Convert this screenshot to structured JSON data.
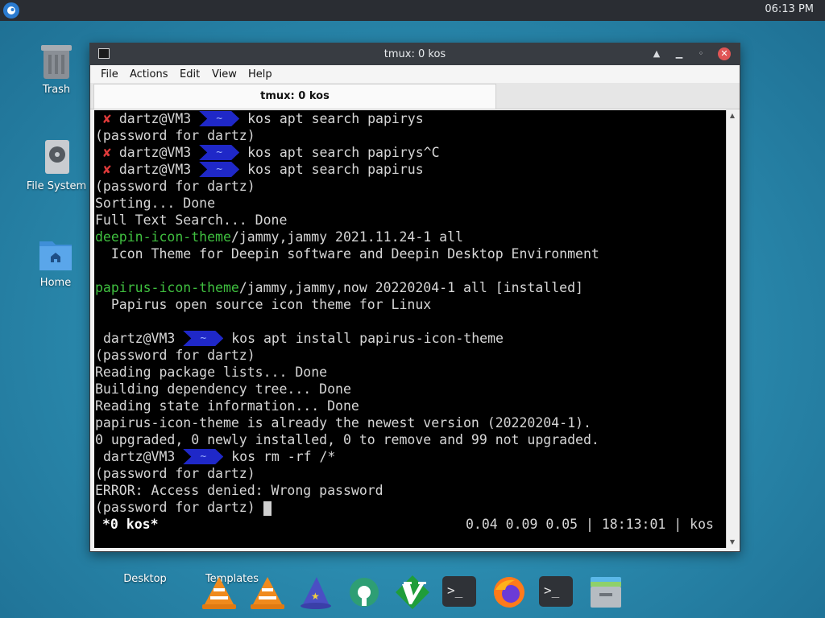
{
  "panel": {
    "clock": "06:13 PM"
  },
  "desktop_icons": [
    {
      "label": "Trash",
      "icon": "trash-icon"
    },
    {
      "label": "File System",
      "icon": "drive-icon"
    },
    {
      "label": "Home",
      "icon": "home-folder-icon"
    },
    {
      "label": "Desktop",
      "icon": "folder-icon"
    },
    {
      "label": "Templates",
      "icon": "folder-icon"
    }
  ],
  "window": {
    "title": "tmux: 0 kos",
    "menu": [
      "File",
      "Actions",
      "Edit",
      "View",
      "Help"
    ],
    "tab_label": "tmux: 0 kos"
  },
  "terminal": {
    "lines": {
      "l1_user": "dartz@VM3",
      "l1_cmd": "kos apt search papirys",
      "l2": "(password for dartz)",
      "l3_user": "dartz@VM3",
      "l3_cmd": "kos apt search papirys^C",
      "l4_user": "dartz@VM3",
      "l4_cmd": "kos apt search papirus",
      "l5": "(password for dartz)",
      "l6": "Sorting... Done",
      "l7": "Full Text Search... Done",
      "l8_pkg": "deepin-icon-theme",
      "l8_rest": "/jammy,jammy 2021.11.24-1 all",
      "l9": "  Icon Theme for Deepin software and Deepin Desktop Environment",
      "l11_pkg": "papirus-icon-theme",
      "l11_rest": "/jammy,jammy,now 20220204-1 all [installed]",
      "l12": "  Papirus open source icon theme for Linux",
      "l14_user": "dartz@VM3",
      "l14_cmd": "kos apt install papirus-icon-theme",
      "l15": "(password for dartz)",
      "l16": "Reading package lists... Done",
      "l17": "Building dependency tree... Done",
      "l18": "Reading state information... Done",
      "l19": "papirus-icon-theme is already the newest version (20220204-1).",
      "l20": "0 upgraded, 0 newly installed, 0 to remove and 99 not upgraded.",
      "l21_user": "dartz@VM3",
      "l21_cmd": "kos rm -rf /*",
      "l22": "(password for dartz)",
      "l23": "ERROR: Access denied: Wrong password",
      "l24": "(password for dartz) "
    },
    "prompt_tilde": "~",
    "fail_mark": "✘",
    "status_left": "*0 kos*",
    "status_right": "0.04 0.09 0.05 | 18:13:01 | kos"
  },
  "dock": [
    "vlc-icon",
    "vlc-icon",
    "wizard-hat-icon",
    "settings-gear-icon",
    "vim-icon",
    "terminal-icon",
    "firefox-icon",
    "terminal-icon",
    "archive-manager-icon"
  ]
}
